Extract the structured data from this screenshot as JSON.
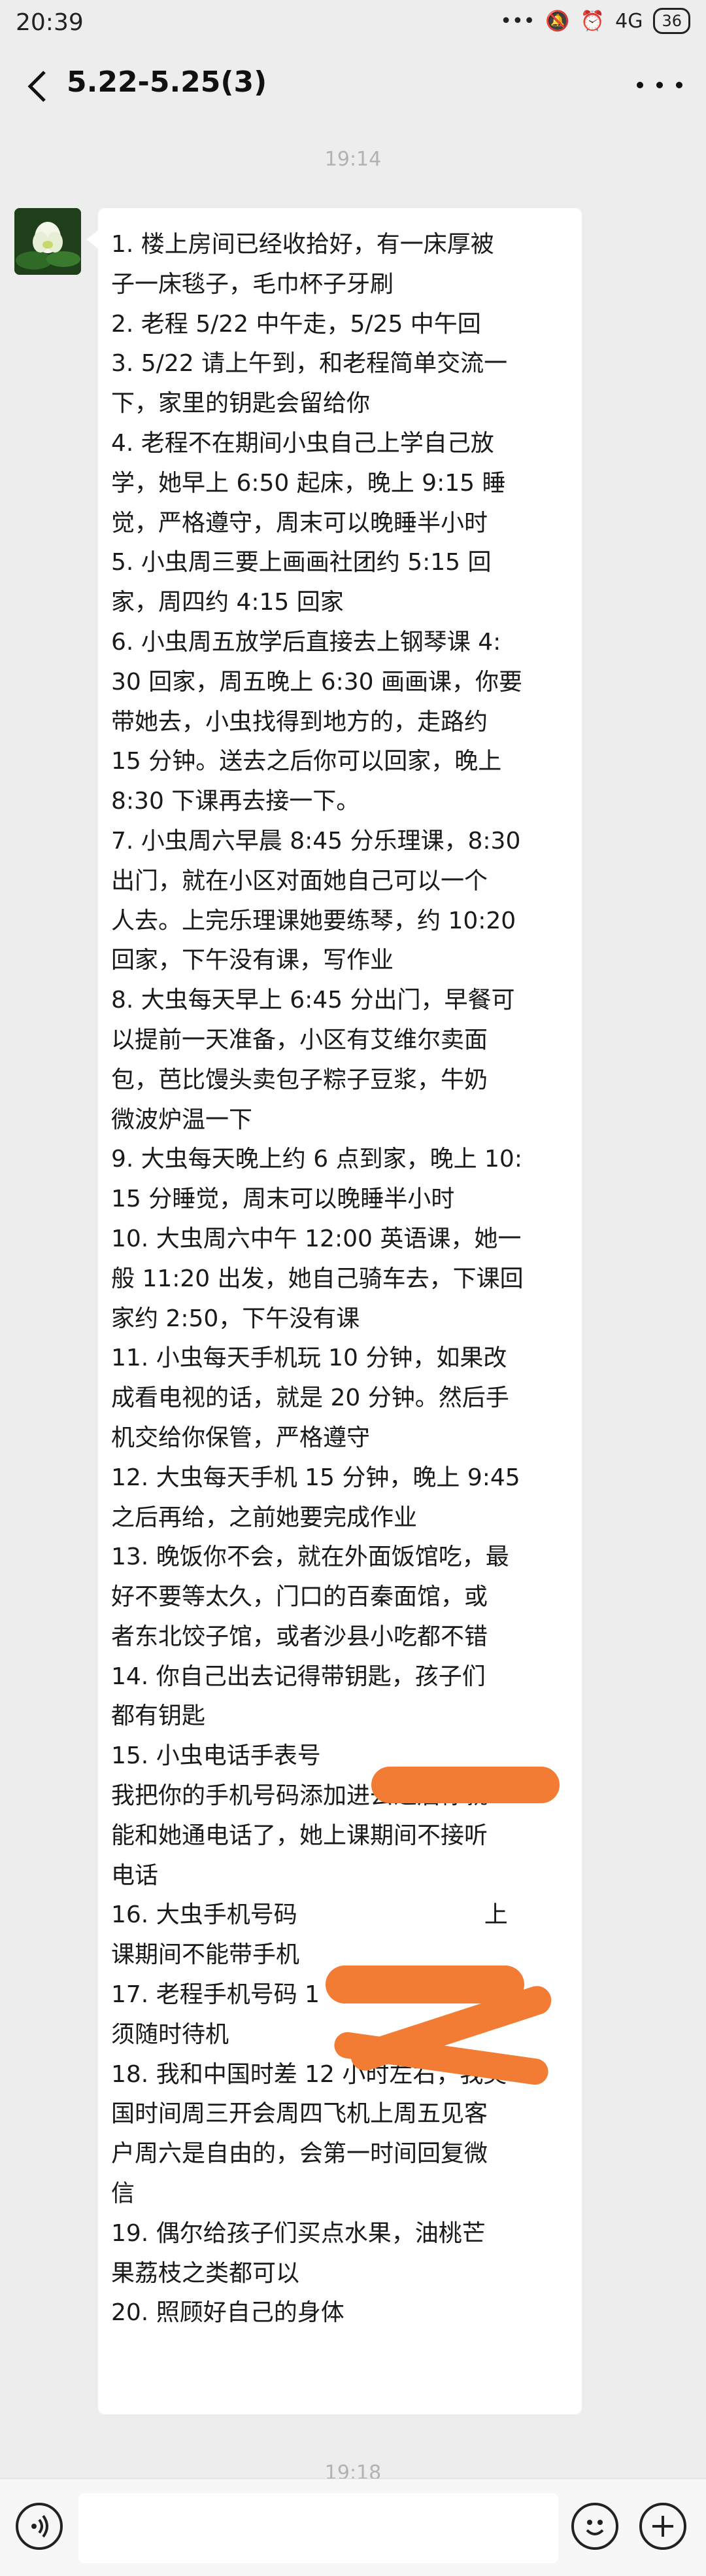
{
  "status_bar": {
    "time": "20:39",
    "network": "4G",
    "battery": "36"
  },
  "header": {
    "title": "5.22-5.25(3)"
  },
  "timestamps": {
    "first": "19:14",
    "second": "19:18"
  },
  "message": {
    "lines": [
      "1. 楼上房间已经收拾好，有一床厚被",
      "子一床毯子，毛巾杯子牙刷",
      "2. 老程 5/22 中午走，5/25 中午回",
      "3. 5/22 请上午到，和老程简单交流一",
      "下，家里的钥匙会留给你",
      "4. 老程不在期间小虫自己上学自己放",
      "学，她早上 6:50 起床，晚上 9:15 睡",
      "觉，严格遵守，周末可以晚睡半小时",
      "5. 小虫周三要上画画社团约 5:15 回",
      "家，周四约 4:15 回家",
      "6. 小虫周五放学后直接去上钢琴课 4:",
      "30 回家，周五晚上 6:30 画画课，你要",
      "带她去，小虫找得到地方的，走路约",
      "15 分钟。送去之后你可以回家，晚上",
      "8:30 下课再去接一下。",
      "7. 小虫周六早晨 8:45 分乐理课，8:30",
      "出门，就在小区对面她自己可以一个",
      "人去。上完乐理课她要练琴，约 10:20",
      "回家，下午没有课，写作业",
      "8. 大虫每天早上 6:45 分出门，早餐可",
      "以提前一天准备，小区有艾维尔卖面",
      "包，芭比馒头卖包子粽子豆浆，牛奶",
      "微波炉温一下",
      "9. 大虫每天晚上约 6 点到家，晚上 10:",
      "15 分睡觉，周末可以晚睡半小时",
      "10. 大虫周六中午 12:00 英语课，她一",
      "般 11:20 出发，她自己骑车去，下课回",
      "家约 2:50，下午没有课",
      "11. 小虫每天手机玩 10 分钟，如果改",
      "成看电视的话，就是 20 分钟。然后手",
      "机交给你保管，严格遵守",
      "12. 大虫每天手机 15 分钟，晚上 9:45",
      "之后再给，之前她要完成作业",
      "13. 晚饭你不会，就在外面饭馆吃，最",
      "好不要等太久，门口的百秦面馆，或",
      "者东北饺子馆，或者沙县小吃都不错",
      "14. 你自己出去记得带钥匙，孩子们",
      "都有钥匙",
      "15. 小虫电话手表号",
      "我把你的手机号码添加进去之后你就",
      "能和她通电话了，她上课期间不接听",
      "电话",
      "16. 大虫手机号码                         上",
      "课期间不能带手机",
      "17. 老程手机号码 1",
      "须随时待机",
      "18. 我和中国时差 12 小时左右，我美",
      "国时间周三开会周四飞机上周五见客",
      "户周六是自由的，会第一时间回复微",
      "信",
      "19. 偶尔给孩子们买点水果，油桃芒",
      "果荔枝之类都可以",
      "20. 照顾好自己的身体"
    ]
  },
  "colors": {
    "background": "#ededed",
    "bubble": "#ffffff",
    "redaction": "#f27c33"
  },
  "icons": {
    "back": "chevron-left-icon",
    "more": "more-dots-icon",
    "voice": "voice-icon",
    "emoji": "emoji-icon",
    "plus": "plus-icon"
  }
}
